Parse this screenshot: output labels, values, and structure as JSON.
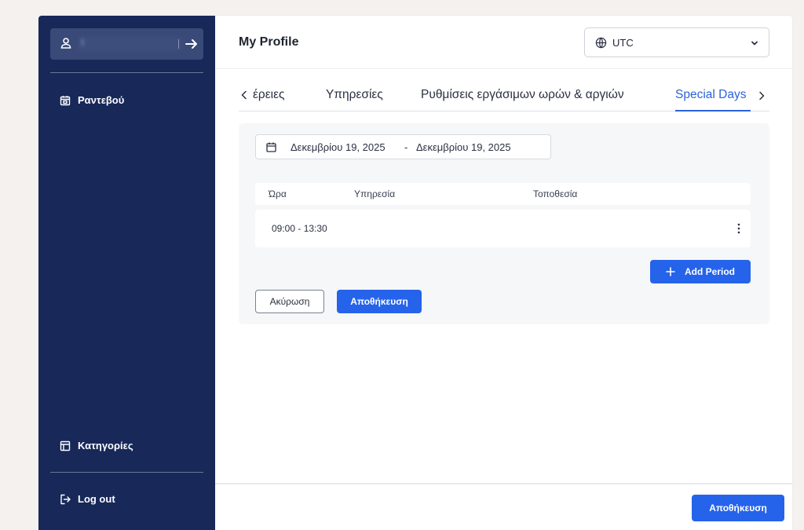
{
  "sidebar": {
    "items": [
      {
        "label": "Ραντεβού",
        "icon": "calendar-icon"
      },
      {
        "label": "Κατηγορίες",
        "icon": "categories-icon"
      },
      {
        "label": "Log out",
        "icon": "logout-icon"
      }
    ]
  },
  "header": {
    "title": "My Profile",
    "timezone": "UTC"
  },
  "tabs": [
    {
      "label": "έρειες"
    },
    {
      "label": "Υπηρεσίες"
    },
    {
      "label": "Ρυθμίσεις εργάσιμων ωρών & αργιών"
    },
    {
      "label": "Special Days",
      "active": true
    }
  ],
  "special_days": {
    "date_start": "Δεκεμβρίου 19, 2025",
    "date_separator": "-",
    "date_end": "Δεκεμβρίου 19, 2025",
    "columns": [
      "Ώρα",
      "Υπηρεσία",
      "Τοποθεσία"
    ],
    "rows": [
      {
        "time": "09:00 - 13:30",
        "service": "",
        "location": ""
      }
    ],
    "add_period_label": "Add Period",
    "cancel_label": "Ακύρωση",
    "save_label": "Αποθήκευση"
  },
  "footer": {
    "save_label": "Αποθήκευση"
  },
  "colors": {
    "sidebar_bg": "#172859",
    "accent": "#2563eb",
    "active_tab": "#2b63d9"
  }
}
